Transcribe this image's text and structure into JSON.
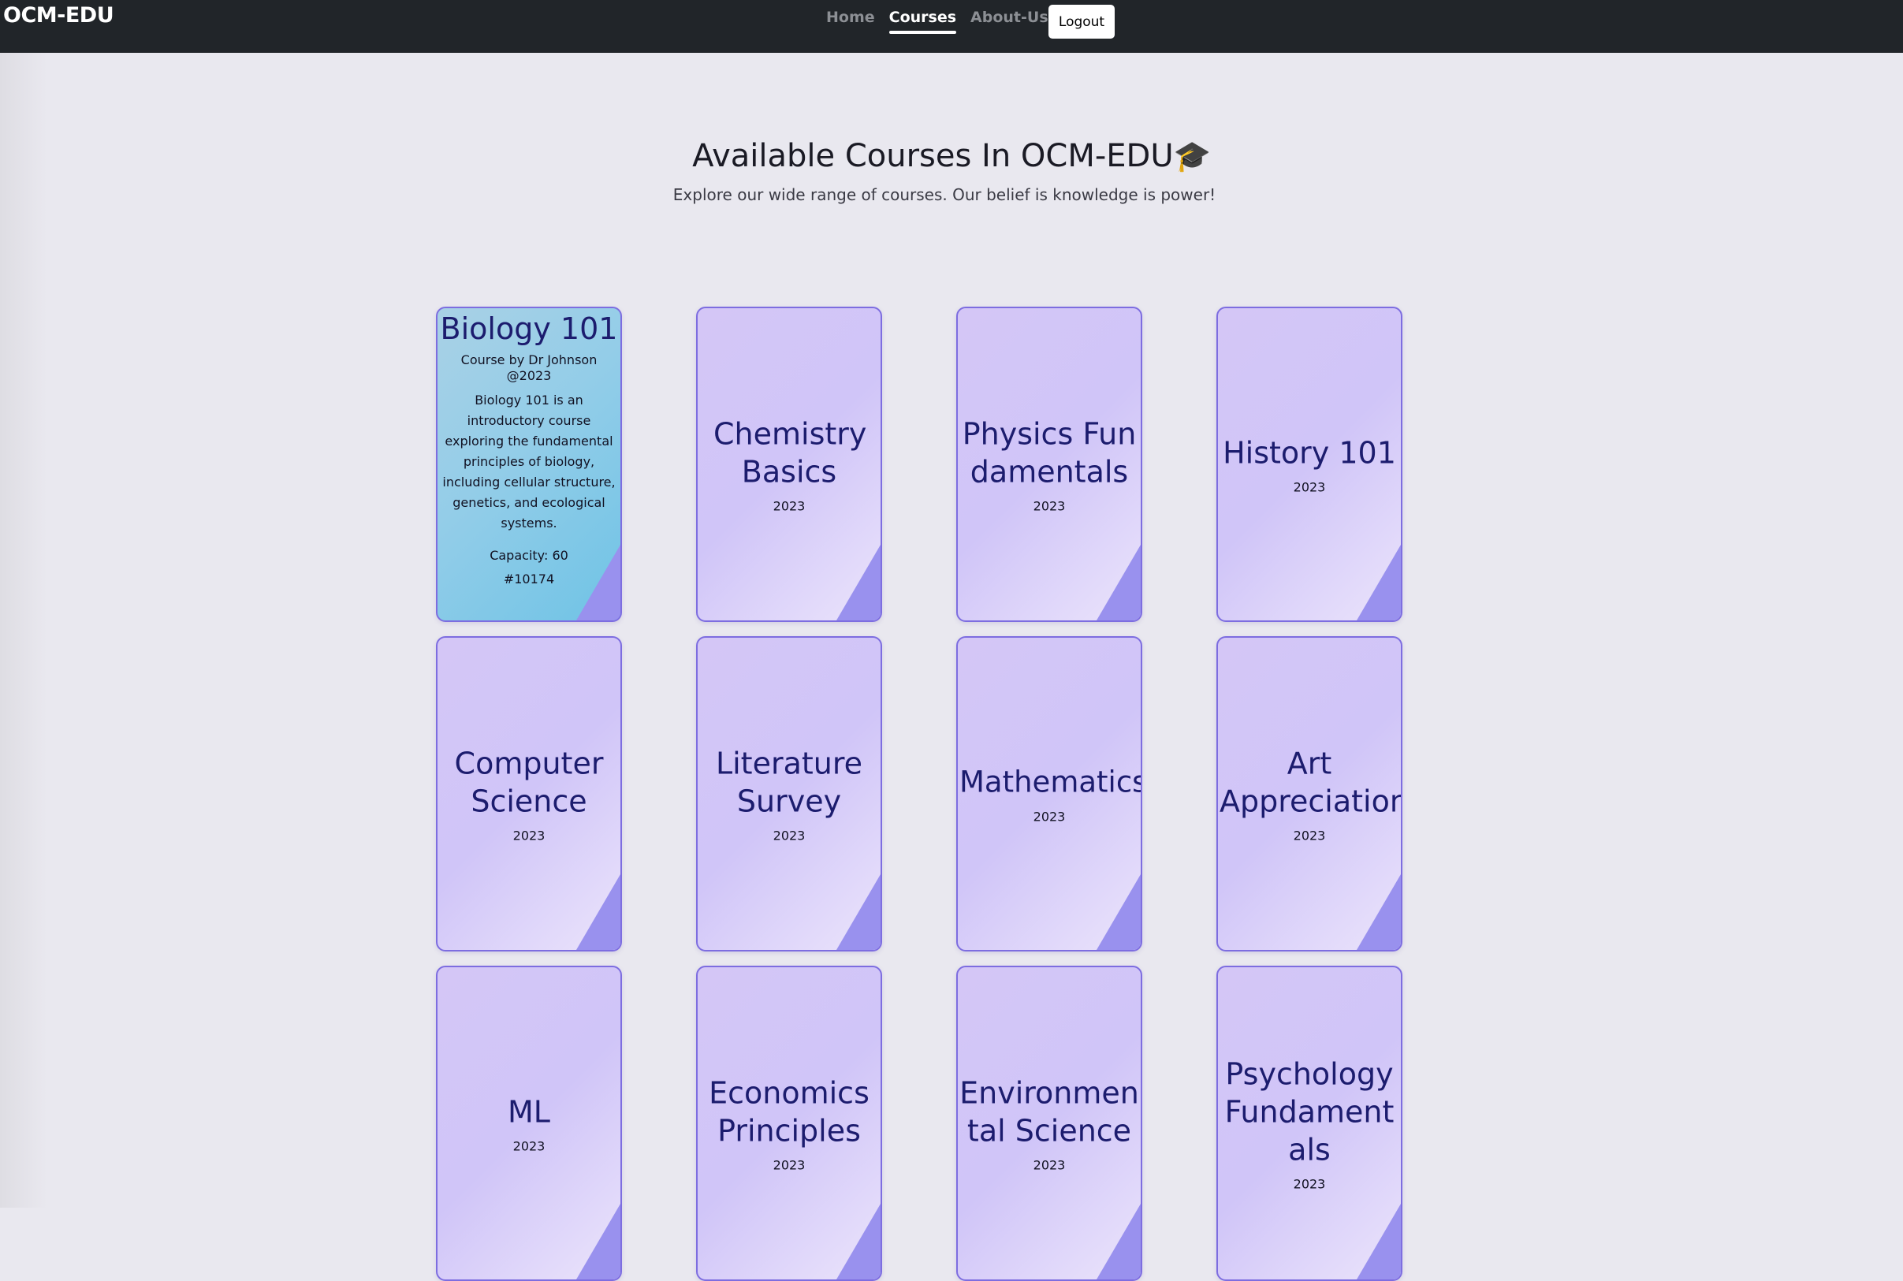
{
  "navbar": {
    "brand": "OCM-EDU",
    "links": [
      {
        "label": "Home",
        "active": false
      },
      {
        "label": "Courses",
        "active": true
      },
      {
        "label": "About-Us",
        "active": false
      }
    ],
    "logout_label": "Logout",
    "background": "#212529"
  },
  "header": {
    "title": "Available Courses In OCM-EDU",
    "title_icon": "graduation-cap-icon",
    "subtitle": "Explore our wide range of courses. Our belief is knowledge is power!"
  },
  "courses": [
    {
      "title": "Biology 101",
      "year": "2023",
      "expanded": true,
      "by": "Course by Dr Johnson @2023",
      "description": "Biology 101 is an introductory course exploring the fundamental principles of biology, including cellular structure, genetics, and ecological systems.",
      "capacity": "Capacity: 60",
      "id": "#10174"
    },
    {
      "title": "Chemistry Basics",
      "year": "2023"
    },
    {
      "title": "Physics Fundamentals",
      "year": "2023"
    },
    {
      "title": "History 101",
      "year": "2023"
    },
    {
      "title": "Computer Science",
      "year": "2023"
    },
    {
      "title": "Literature Survey",
      "year": "2023"
    },
    {
      "title": "Mathematics",
      "year": "2023"
    },
    {
      "title": "Art Appreciation",
      "year": "2023"
    },
    {
      "title": "ML",
      "year": "2023"
    },
    {
      "title": "Economics Principles",
      "year": "2023"
    },
    {
      "title": "Environmental Science",
      "year": "2023"
    },
    {
      "title": "Psychology Fundamentals",
      "year": "2023"
    }
  ],
  "colors": {
    "card_bg": "#d4c6f6",
    "card_border": "#7d6de0",
    "card_fold": "#9991ee",
    "card_title": "#1c1c6e",
    "expanded_bg": "#93cde8"
  }
}
